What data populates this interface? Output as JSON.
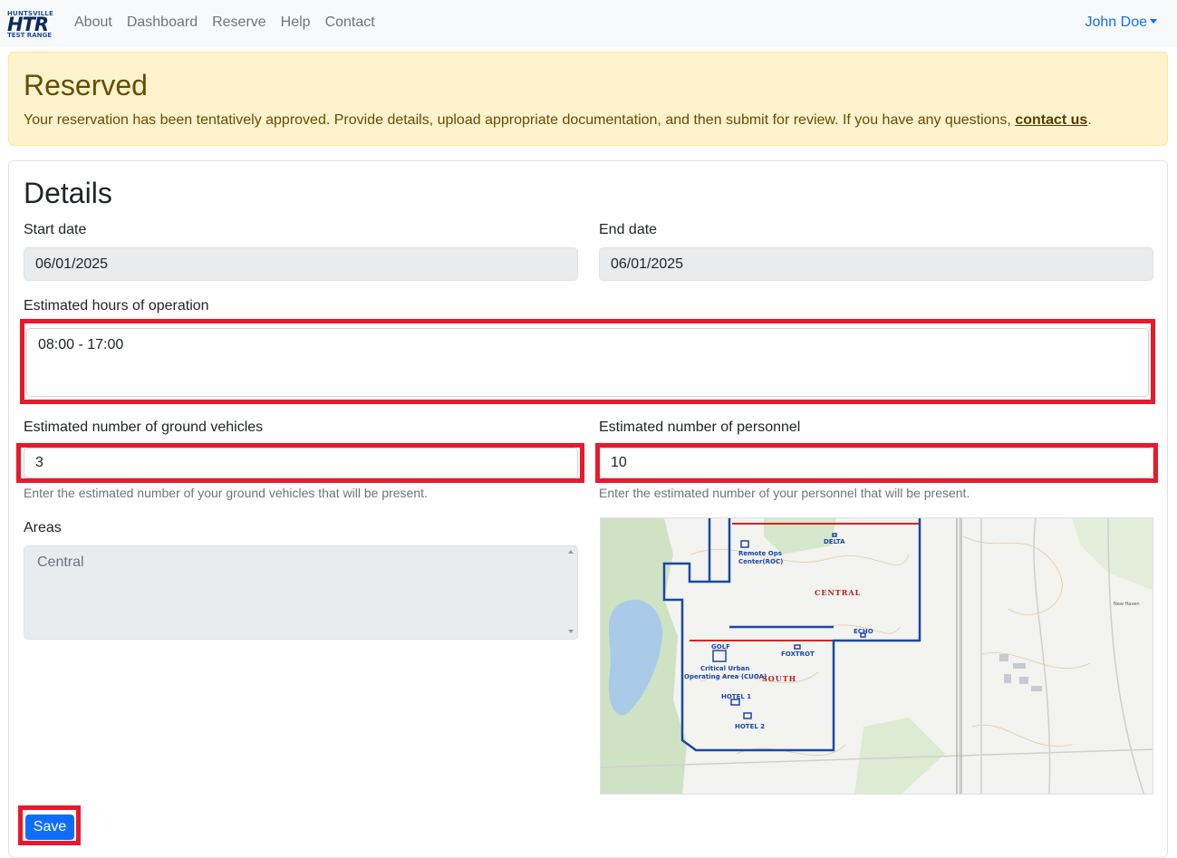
{
  "nav": {
    "logo": {
      "top": "HUNTSVILLE",
      "main": "HTR",
      "bottom": "TEST RANGE"
    },
    "links": [
      "About",
      "Dashboard",
      "Reserve",
      "Help",
      "Contact"
    ],
    "user": "John Doe"
  },
  "alert": {
    "title": "Reserved",
    "message": "Your reservation has been tentatively approved. Provide details, upload appropriate documentation, and then submit for review. If you have any questions, ",
    "link": "contact us",
    "suffix": "."
  },
  "details": {
    "title": "Details",
    "start_label": "Start date",
    "start_value": "06/01/2025",
    "end_label": "End date",
    "end_value": "06/01/2025",
    "hours_label": "Estimated hours of operation",
    "hours_value": "08:00 - 17:00",
    "vehicles_label": "Estimated number of ground vehicles",
    "vehicles_value": "3",
    "vehicles_help": "Enter the estimated number of your ground vehicles that will be present.",
    "personnel_label": "Estimated number of personnel",
    "personnel_value": "10",
    "personnel_help": "Enter the estimated number of your personnel that will be present.",
    "areas_label": "Areas",
    "areas_value": "Central"
  },
  "map": {
    "labels": {
      "delta": "DELTA",
      "roc1": "Remote Ops",
      "roc2": "Center(ROC)",
      "central": "CENTRAL",
      "echo": "ECHO",
      "golf": "GOLF",
      "foxtrot": "FOXTROT",
      "cuoa1": "Critical Urban",
      "cuoa2": "Operating Area (CUOA)",
      "south": "SOUTH",
      "hotel1": "HOTEL 1",
      "hotel2": "HOTEL 2",
      "newhaven": "New Haven"
    },
    "colors": {
      "boundary": "#1a47a8",
      "redline": "#e02020"
    }
  },
  "save_label": "Save"
}
